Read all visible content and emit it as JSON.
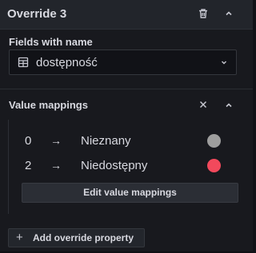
{
  "override": {
    "title": "Override 3"
  },
  "fields": {
    "label": "Fields with name",
    "selected": "dostępność"
  },
  "value_mappings": {
    "label": "Value mappings",
    "rows": [
      {
        "value": "0",
        "arrow": "→",
        "text": "Nieznany",
        "color": "#9e9e9e"
      },
      {
        "value": "2",
        "arrow": "→",
        "text": "Niedostępny",
        "color": "#f2495c"
      }
    ],
    "edit_label": "Edit value mappings"
  },
  "add_override": {
    "plus": "+",
    "label": "Add override property"
  },
  "icons": {
    "delete": "trash-icon",
    "collapse": "chevron-up-icon",
    "field": "table-icon",
    "dropdown": "chevron-down-icon",
    "remove": "close-icon"
  }
}
